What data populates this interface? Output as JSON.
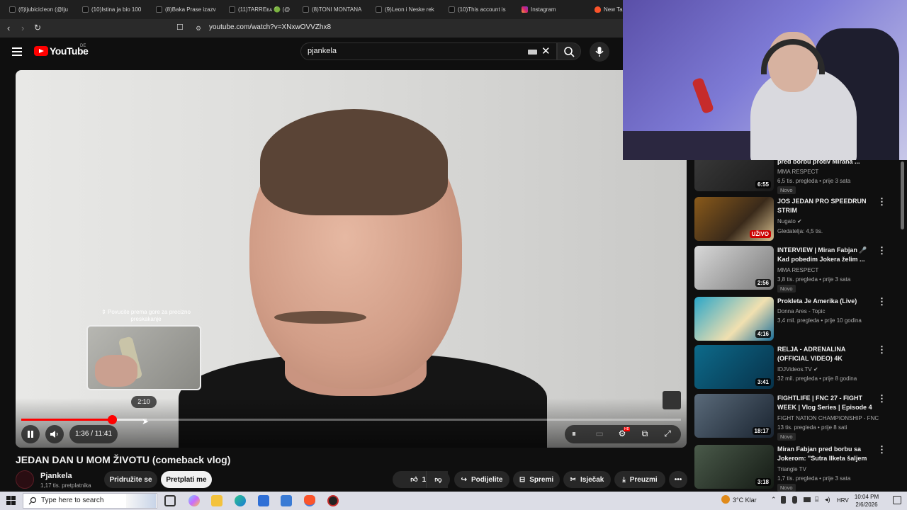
{
  "browser": {
    "tabs": [
      {
        "label": "(6)ljubicicleon (@lju",
        "icon": "tiktok-icon"
      },
      {
        "label": "(10)Istina ja bio 100",
        "icon": "tiktok-icon"
      },
      {
        "label": "(8)Baka Prase izazv",
        "icon": "tiktok-icon"
      },
      {
        "label": "(11)TARREᴇᴀ 🟢 (@",
        "icon": "tiktok-icon"
      },
      {
        "label": "(8)TONI MONTANA",
        "icon": "tiktok-icon"
      },
      {
        "label": "(9)Leon i Neske rek",
        "icon": "tiktok-icon"
      },
      {
        "label": "(10)This account is",
        "icon": "tiktok-icon"
      },
      {
        "label": "Instagram",
        "icon": "instagram-icon"
      },
      {
        "label": "New Ta",
        "icon": "brave-icon"
      }
    ],
    "url": "youtube.com/watch?v=XNxwOVVZhx8"
  },
  "youtube": {
    "logo_text": "YouTube",
    "country_code": "DE",
    "search_value": "pjankela"
  },
  "player": {
    "hint_text": "⇕ Povucite prema gore za precizno preskakanje",
    "preview_time": "2:10",
    "time_display": "1:36 / 11:41",
    "progress_fraction": 0.137,
    "buffered_fraction": 0.19,
    "hd_badge": "HD"
  },
  "video": {
    "title": "JEDAN DAN U MOM ŽIVOTU (comeback vlog)",
    "channel": "Pjankela",
    "subscribers": "1,17 tis. pretplatnika",
    "join_label": "Pridružite se",
    "subscribe_label": "Pretplati me",
    "likes": "17",
    "share_label": "Podijelite",
    "save_label": "Spremi",
    "clip_label": "Isječak",
    "download_label": "Preuzmi"
  },
  "recommendations": [
    {
      "title": "pred borbu protiv Mirana ...",
      "channel": "MMA RESPECT",
      "meta": "6,5 tis. pregleda • prije 3 sata",
      "badge": "Novo",
      "duration": "6:55"
    },
    {
      "title": "JOS JEDAN PRO SPEEDRUN STRIM",
      "channel": "Nugato ✔",
      "meta": "Gledatelja: 4,5 tis.",
      "badge": "",
      "duration": "UŽIVO"
    },
    {
      "title": "INTERVIEW | Miran Fabjan 🎤 Kad pobedim Jokera želim ...",
      "channel": "MMA RESPECT",
      "meta": "3,8 tis. pregleda • prije 3 sata",
      "badge": "Novo",
      "duration": "2:56"
    },
    {
      "title": "Prokleta Je Amerika (Live)",
      "channel": "Donna Ares - Topic",
      "meta": "3,4 mil. pregleda • prije 10 godina",
      "badge": "",
      "duration": "4:16"
    },
    {
      "title": "RELJA - ADRENALINA (OFFICIAL VIDEO) 4K",
      "channel": "IDJVideos.TV ✔",
      "meta": "32 mil. pregleda • prije 8 godina",
      "badge": "",
      "duration": "3:41"
    },
    {
      "title": "FIGHTLIFE | FNC 27 - FIGHT WEEK | Vlog Series | Episode 4",
      "channel": "FIGHT NATION CHAMPIONSHIP - FNC",
      "meta": "13 tis. pregleda • prije 8 sati",
      "badge": "Novo",
      "duration": "18:17"
    },
    {
      "title": "Miran Fabjan pred borbu sa Jokerom: \"Sutra Ilketa šaljem ...",
      "channel": "Triangle TV",
      "meta": "1,7 tis. pregleda • prije 3 sata",
      "badge": "Novo",
      "duration": "3:18"
    }
  ],
  "taskbar": {
    "search_placeholder": "Type here to search",
    "weather": "3°C  Klar",
    "language": "HRV",
    "time": "10:04 PM",
    "date": "2/6/2026"
  },
  "colors": {
    "accent": "#ff0000",
    "background": "#0f0f0f",
    "pill": "#272727"
  }
}
